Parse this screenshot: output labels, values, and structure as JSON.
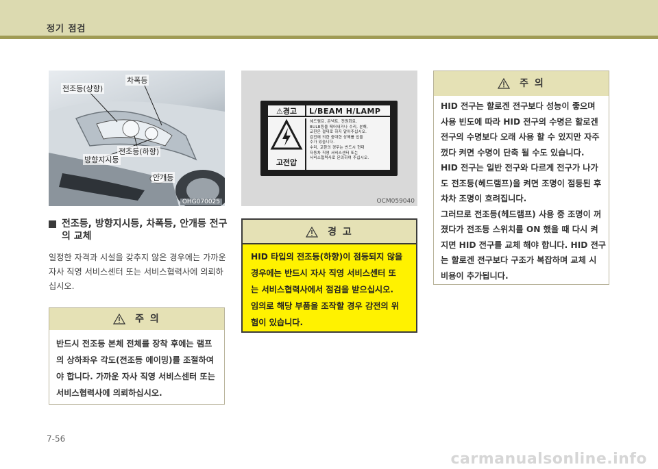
{
  "header": {
    "section_title": "정기 점검"
  },
  "photo": {
    "callouts": {
      "headlamp_high": "전조등(상향)",
      "side_marker": "차폭등",
      "headlamp_low": "전조등(하향)",
      "turn_signal": "방향지시등",
      "fog_lamp": "안개등"
    },
    "code": "OHG070025"
  },
  "label_photo": {
    "warning_word": "⚠경고",
    "model": "L/BEAM H/LAMP",
    "high_voltage": "고전압",
    "text_lines": [
      "헤드램프, 콘넥트, 전원회로,",
      "BULB등을 떼어내거나 수리, 분해,",
      "교환은 절대로 하지 말아주십시오.",
      "감전에 의한 중대한 상해를 입을",
      "수가 있습니다.",
      "수리, 교환의 경우는 반드시 현대",
      "자동차 직영 서비스센터 또는",
      "서비스협력사로 문의하여 주십시오."
    ],
    "code": "OCM059040"
  },
  "section": {
    "heading": "전조등, 방향지시등, 차폭등, 안개등 전구의 교체",
    "paragraph": "일정한 자격과 시설을 갖추지 않은 경우에는 가까운 자사 직영 서비스센터 또는 서비스협력사에 의뢰하십시오."
  },
  "caution_left": {
    "title": "주    의",
    "lines": [
      "반드시 전조등 본체 전체를 장착 후에는 램프",
      "의 상하좌우 각도(전조등 에이밍)를 조절하여",
      "야 합니다. 가까운 자사 직영 서비스센터 또는",
      "서비스협력사에 의뢰하십시오."
    ]
  },
  "warning_mid": {
    "title": "경    고",
    "lines": [
      "HID 타입의 전조등(하향)이 점등되지 않을",
      "경우에는 반드시 자사 직영 서비스센터 또",
      "는 서비스협력사에서 점검을 받으십시오.",
      "임의로 해당 부품을 조작할 경우 감전의 위",
      "험이 있습니다."
    ]
  },
  "caution_right": {
    "title": "주    의",
    "lines": [
      "HID 전구는 할로겐 전구보다 성능이 좋으며",
      "사용 빈도에 따라 HID 전구의 수명은 할로겐",
      "전구의 수명보다 오래 사용 할 수 있지만 자주",
      "껐다 켜면 수명이 단축 될 수도 있습니다.",
      "HID 전구는 일반 전구와 다르게 전구가 나가",
      "도 전조등(헤드램프)을 켜면 조명이 점등된 후",
      "차차 조명이 흐려집니다.",
      "그러므로 전조등(헤드램프) 사용 중 조명이 꺼",
      "졌다가 전조등 스위치를 ON 했을 때 다시 켜",
      "지면 HID 전구를 교체 해야 합니다. HID 전구",
      "는 할로겐 전구보다 구조가 복잡하며 교체 시",
      "비용이 추가됩니다."
    ]
  },
  "footer": {
    "page_number": "7-56",
    "watermark": "carmanualsonline.info"
  }
}
